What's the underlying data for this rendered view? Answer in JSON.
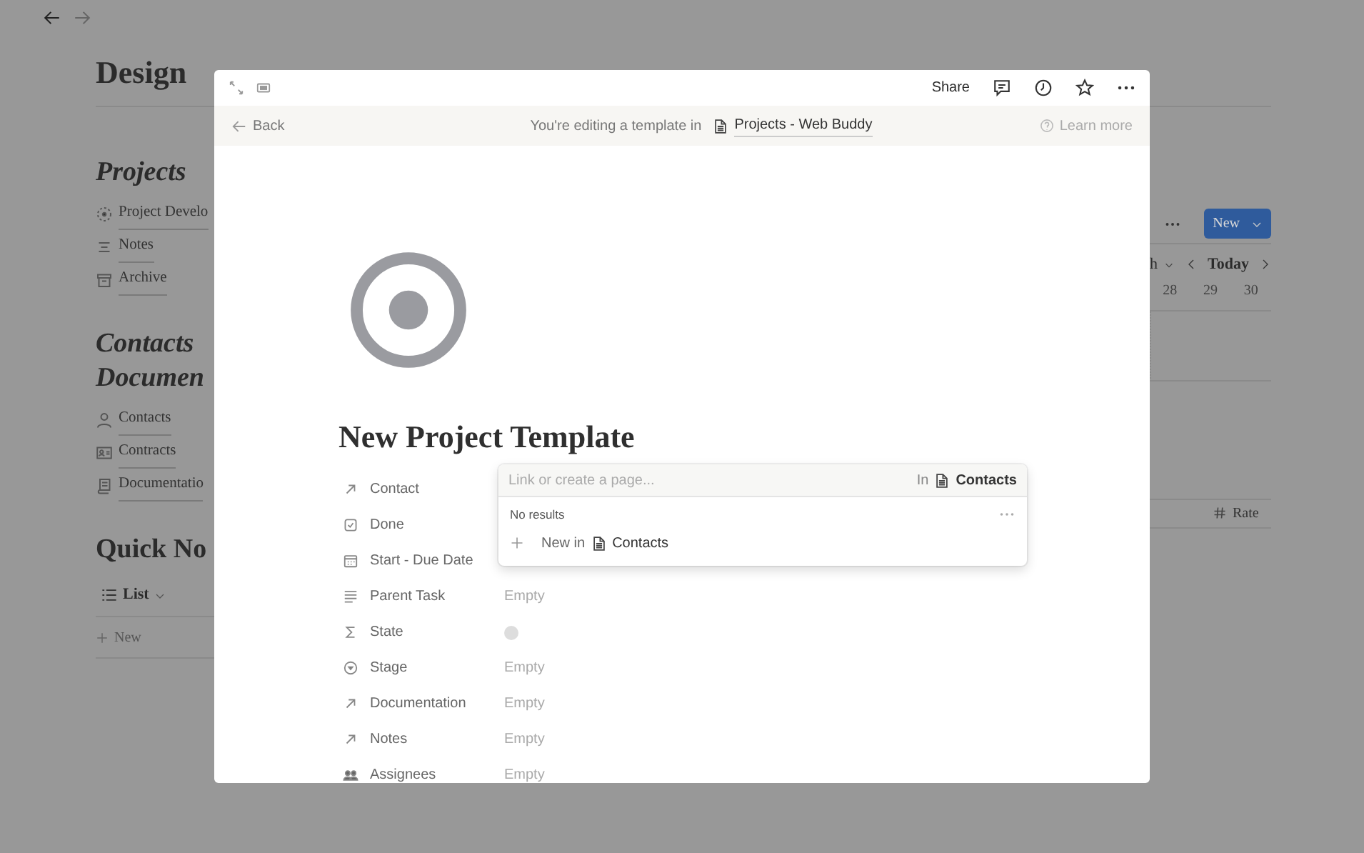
{
  "background_page": {
    "title": "Design",
    "sections": [
      {
        "heading": "Projects",
        "italic": true,
        "kind": "links",
        "items": [
          {
            "label": "Project Develo"
          },
          {
            "label": "Notes"
          },
          {
            "label": "Archive"
          }
        ]
      },
      {
        "heading": "Contacts",
        "heading_line_2": "Documen",
        "italic": true,
        "kind": "links",
        "items": [
          {
            "label": "Contacts"
          },
          {
            "label": "Contracts"
          },
          {
            "label": "Documentatio"
          }
        ]
      },
      {
        "heading": "Quick No",
        "italic": false,
        "kind": "list_view",
        "view": "List",
        "new_row": "New"
      }
    ],
    "right_panel": {
      "new_button": "New",
      "view_menu": "h",
      "today": "Today",
      "dates": [
        "28",
        "29",
        "30"
      ],
      "column_header": "Rate"
    }
  },
  "modal": {
    "toolbar": {
      "share": "Share"
    },
    "banner": {
      "back": "Back",
      "text": "You're editing a template in",
      "page": "Projects - Web Buddy",
      "learn_more": "Learn more"
    },
    "title": "New Project Template",
    "properties": [
      {
        "label": "Contact",
        "kind": "relation"
      },
      {
        "label": "Done",
        "kind": "checkbox"
      },
      {
        "label": "Start - Due Date",
        "kind": "date"
      },
      {
        "label": "Parent Task",
        "kind": "text",
        "value": "Empty"
      },
      {
        "label": "State",
        "kind": "formula"
      },
      {
        "label": "Stage",
        "kind": "select",
        "value": "Empty"
      },
      {
        "label": "Documentation",
        "kind": "relation",
        "value": "Empty"
      },
      {
        "label": "Notes",
        "kind": "relation",
        "value": "Empty"
      },
      {
        "label": "Assignees",
        "kind": "people",
        "value": "Empty"
      }
    ],
    "popup": {
      "placeholder": "Link or create a page...",
      "scope_prefix": "In",
      "scope": "Contacts",
      "status": "No results",
      "create_prefix": "New in",
      "create_target": "Contacts"
    }
  }
}
